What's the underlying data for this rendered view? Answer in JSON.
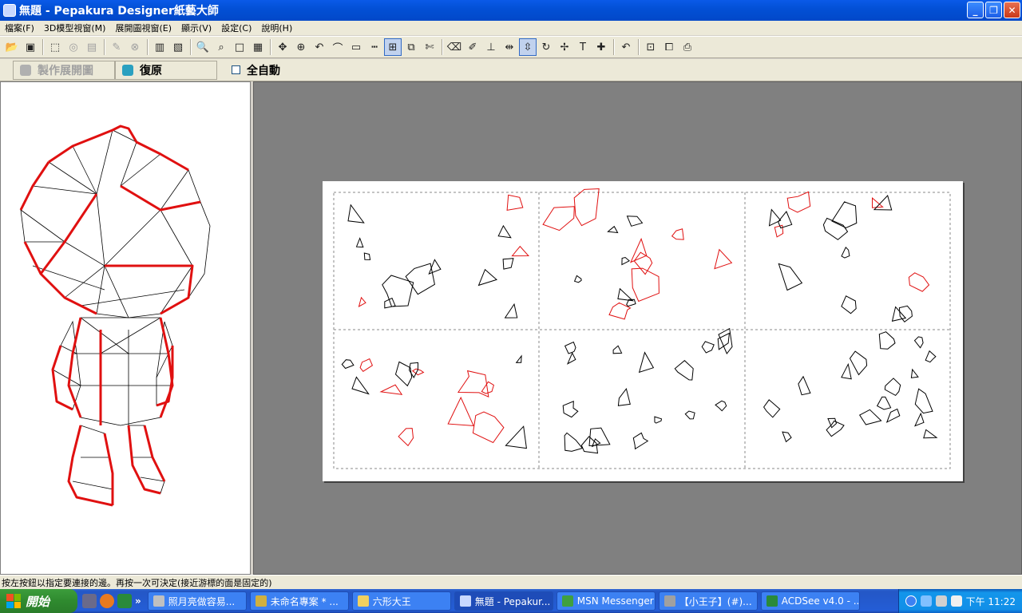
{
  "window": {
    "title": "無題 - Pepakura Designer紙藝大師",
    "btn_min": "_",
    "btn_max": "❐",
    "btn_close": "✕"
  },
  "menu": [
    "檔案(F)",
    "3D模型視窗(M)",
    "展開圖視窗(E)",
    "顯示(V)",
    "設定(C)",
    "說明(H)"
  ],
  "toolbar2": {
    "unfold_label": "製作展開圖",
    "restore_label": "復原",
    "auto_label": "全自動",
    "auto_checked": false
  },
  "status": {
    "text": "按左按鈕以指定要連接的邊。再按一次可決定(接近游標的面是固定的)"
  },
  "taskbar": {
    "start_label": "開始",
    "tasks": [
      {
        "label": "照月亮做容易...",
        "active": false
      },
      {
        "label": "未命名專案 * ...",
        "active": false
      },
      {
        "label": "六形大王",
        "active": false
      },
      {
        "label": "無題 - Pepakur...",
        "active": true
      },
      {
        "label": "MSN Messenger",
        "active": false
      },
      {
        "label": "【小王子】(#)...",
        "active": false
      },
      {
        "label": "ACDSee v4.0 - ...",
        "active": false
      }
    ],
    "more": "»",
    "clock": "下午 11:22"
  },
  "colors": {
    "seam": "#e01010",
    "edge": "#000000",
    "workspace": "#808080",
    "titlebar": "#0350d6"
  }
}
